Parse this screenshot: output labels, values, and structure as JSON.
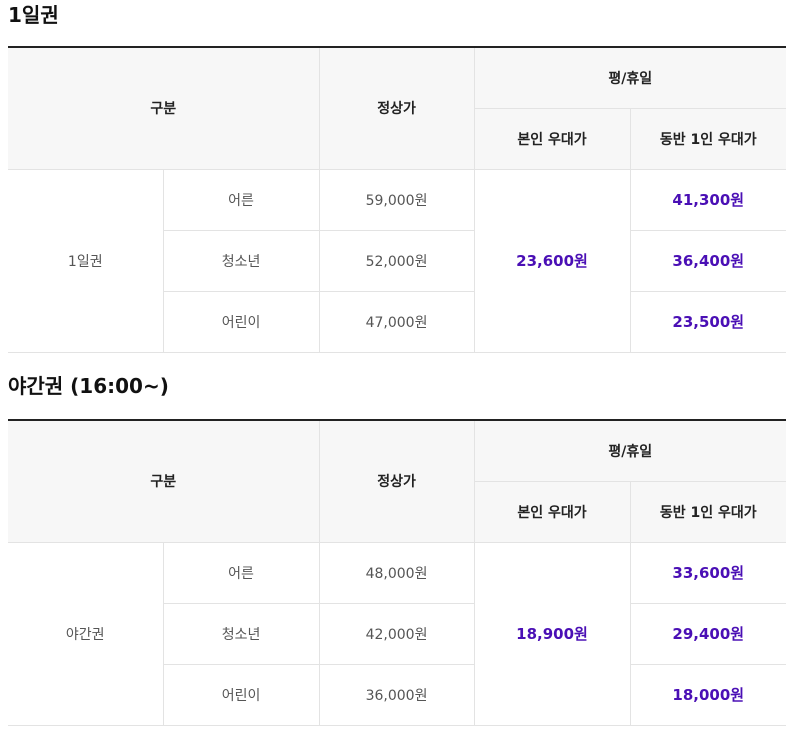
{
  "sections": [
    {
      "title": "1일권",
      "header": {
        "category": "구분",
        "regular_price": "정상가",
        "weekday_holiday": "평/휴일",
        "self_discount": "본인 우대가",
        "companion_discount": "동반 1인 우대가"
      },
      "ticket_name": "1일권",
      "shared_self_price": "23,600원",
      "rows": [
        {
          "type": "어른",
          "regular": "59,000원",
          "companion": "41,300원"
        },
        {
          "type": "청소년",
          "regular": "52,000원",
          "companion": "36,400원"
        },
        {
          "type": "어린이",
          "regular": "47,000원",
          "companion": "23,500원"
        }
      ]
    },
    {
      "title": "야간권 (16:00~)",
      "header": {
        "category": "구분",
        "regular_price": "정상가",
        "weekday_holiday": "평/휴일",
        "self_discount": "본인 우대가",
        "companion_discount": "동반 1인 우대가"
      },
      "ticket_name": "야간권",
      "shared_self_price": "18,900원",
      "rows": [
        {
          "type": "어른",
          "regular": "48,000원",
          "companion": "33,600원"
        },
        {
          "type": "청소년",
          "regular": "42,000원",
          "companion": "29,400원"
        },
        {
          "type": "어린이",
          "regular": "36,000원",
          "companion": "18,000원"
        }
      ]
    }
  ],
  "colors": {
    "promo_price": "#4a0fb5",
    "header_bg": "#f7f7f7",
    "top_border": "#222222"
  }
}
